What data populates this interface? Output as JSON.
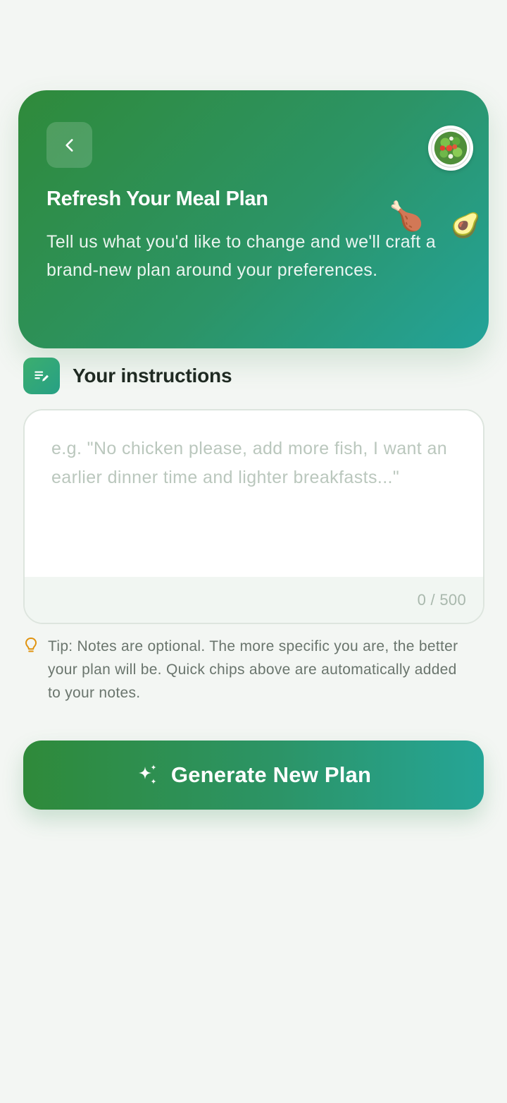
{
  "header": {
    "back_icon": "chevron-left-icon",
    "avatar_icon": "salad-bowl-icon",
    "title": "Refresh Your Meal Plan",
    "description": "Tell us what you'd like to change and we'll craft a brand-new plan around your preferences.",
    "decorations": {
      "chicken": "🍗",
      "avocado": "🥑"
    }
  },
  "instructions": {
    "section_icon": "edit-notes-icon",
    "section_title": "Your instructions",
    "value": "",
    "placeholder": "e.g. \"No chicken please, add more fish, I want an earlier dinner time and lighter breakfasts...\"",
    "char_count": "0 / 500"
  },
  "tip": {
    "icon": "lightbulb-icon",
    "text": "Tip: Notes are optional. The more specific you are, the better your plan will be. Quick chips above are automatically added to your notes."
  },
  "generate_button": {
    "icon": "sparkles-icon",
    "label": "Generate New Plan"
  },
  "colors": {
    "background": "#f3f6f3",
    "brand_green": "#2f8a3a",
    "brand_teal": "#23a39a",
    "tip_icon": "#e0930f",
    "placeholder": "#bac7bd"
  }
}
